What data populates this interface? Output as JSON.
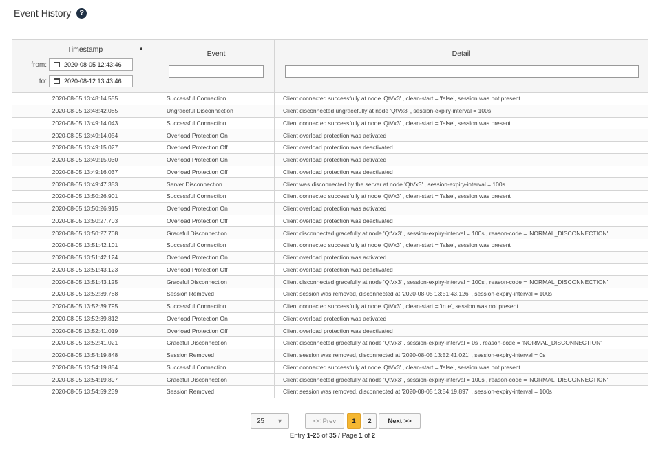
{
  "header": {
    "title": "Event History",
    "help_icon": "question-circle-icon"
  },
  "table": {
    "columns": {
      "timestamp": "Timestamp",
      "event": "Event",
      "detail": "Detail"
    },
    "sort_indicator": "▲",
    "filters": {
      "from_label": "from:",
      "from_value": "2020-08-05 12:43:46",
      "to_label": "to:",
      "to_value": "2020-08-12 13:43:46",
      "event_filter": "",
      "detail_filter": ""
    },
    "rows": [
      {
        "timestamp": "2020-08-05 13:48:14.555",
        "event": "Successful Connection",
        "detail": "Client connected successfully at node 'QtVx3' , clean-start = 'false', session was not present"
      },
      {
        "timestamp": "2020-08-05 13:48:42.085",
        "event": "Ungraceful Disconnection",
        "detail": "Client disconnected ungracefully at node 'QtVx3' , session-expiry-interval = 100s"
      },
      {
        "timestamp": "2020-08-05 13:49:14.043",
        "event": "Successful Connection",
        "detail": "Client connected successfully at node 'QtVx3' , clean-start = 'false', session was present"
      },
      {
        "timestamp": "2020-08-05 13:49:14.054",
        "event": "Overload Protection On",
        "detail": "Client overload protection was activated"
      },
      {
        "timestamp": "2020-08-05 13:49:15.027",
        "event": "Overload Protection Off",
        "detail": "Client overload protection was deactivated"
      },
      {
        "timestamp": "2020-08-05 13:49:15.030",
        "event": "Overload Protection On",
        "detail": "Client overload protection was activated"
      },
      {
        "timestamp": "2020-08-05 13:49:16.037",
        "event": "Overload Protection Off",
        "detail": "Client overload protection was deactivated"
      },
      {
        "timestamp": "2020-08-05 13:49:47.353",
        "event": "Server Disconnection",
        "detail": "Client was disconnected by the server at node 'QtVx3' , session-expiry-interval = 100s"
      },
      {
        "timestamp": "2020-08-05 13:50:26.901",
        "event": "Successful Connection",
        "detail": "Client connected successfully at node 'QtVx3' , clean-start = 'false', session was present"
      },
      {
        "timestamp": "2020-08-05 13:50:26.915",
        "event": "Overload Protection On",
        "detail": "Client overload protection was activated"
      },
      {
        "timestamp": "2020-08-05 13:50:27.703",
        "event": "Overload Protection Off",
        "detail": "Client overload protection was deactivated"
      },
      {
        "timestamp": "2020-08-05 13:50:27.708",
        "event": "Graceful Disconnection",
        "detail": "Client disconnected gracefully at node 'QtVx3' , session-expiry-interval = 100s , reason-code = 'NORMAL_DISCONNECTION'"
      },
      {
        "timestamp": "2020-08-05 13:51:42.101",
        "event": "Successful Connection",
        "detail": "Client connected successfully at node 'QtVx3' , clean-start = 'false', session was present"
      },
      {
        "timestamp": "2020-08-05 13:51:42.124",
        "event": "Overload Protection On",
        "detail": "Client overload protection was activated"
      },
      {
        "timestamp": "2020-08-05 13:51:43.123",
        "event": "Overload Protection Off",
        "detail": "Client overload protection was deactivated"
      },
      {
        "timestamp": "2020-08-05 13:51:43.125",
        "event": "Graceful Disconnection",
        "detail": "Client disconnected gracefully at node 'QtVx3' , session-expiry-interval = 100s , reason-code = 'NORMAL_DISCONNECTION'"
      },
      {
        "timestamp": "2020-08-05 13:52:39.788",
        "event": "Session Removed",
        "detail": "Client session was removed, disconnected at '2020-08-05 13:51:43.126' , session-expiry-interval = 100s"
      },
      {
        "timestamp": "2020-08-05 13:52:39.795",
        "event": "Successful Connection",
        "detail": "Client connected successfully at node 'QtVx3' , clean-start = 'true', session was not present"
      },
      {
        "timestamp": "2020-08-05 13:52:39.812",
        "event": "Overload Protection On",
        "detail": "Client overload protection was activated"
      },
      {
        "timestamp": "2020-08-05 13:52:41.019",
        "event": "Overload Protection Off",
        "detail": "Client overload protection was deactivated"
      },
      {
        "timestamp": "2020-08-05 13:52:41.021",
        "event": "Graceful Disconnection",
        "detail": "Client disconnected gracefully at node 'QtVx3' , session-expiry-interval = 0s , reason-code = 'NORMAL_DISCONNECTION'"
      },
      {
        "timestamp": "2020-08-05 13:54:19.848",
        "event": "Session Removed",
        "detail": "Client session was removed, disconnected at '2020-08-05 13:52:41.021' , session-expiry-interval = 0s"
      },
      {
        "timestamp": "2020-08-05 13:54:19.854",
        "event": "Successful Connection",
        "detail": "Client connected successfully at node 'QtVx3' , clean-start = 'false', session was not present"
      },
      {
        "timestamp": "2020-08-05 13:54:19.897",
        "event": "Graceful Disconnection",
        "detail": "Client disconnected gracefully at node 'QtVx3' , session-expiry-interval = 100s , reason-code = 'NORMAL_DISCONNECTION'"
      },
      {
        "timestamp": "2020-08-05 13:54:59.239",
        "event": "Session Removed",
        "detail": "Client session was removed, disconnected at '2020-08-05 13:54:19.897' , session-expiry-interval = 100s"
      }
    ]
  },
  "pagination": {
    "per_page": "25",
    "prev_label": "<< Prev",
    "pages": [
      "1",
      "2"
    ],
    "current_page": "1",
    "next_label": "Next >>",
    "entry_prefix": "Entry ",
    "entry_range": "1-25",
    "entry_of": " of ",
    "entry_total": "35",
    "entry_page_label": " / Page ",
    "entry_page": "1",
    "entry_page_of": " of ",
    "entry_page_total": "2"
  }
}
